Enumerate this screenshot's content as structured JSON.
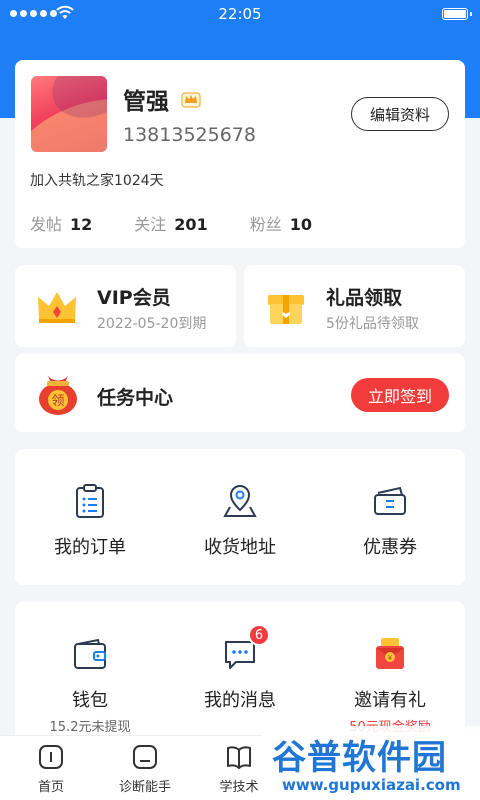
{
  "status_bar": {
    "time": "22:05"
  },
  "profile": {
    "name": "管强",
    "phone": "13813525678",
    "edit_label": "编辑资料",
    "joined": "加入共轨之家1024天",
    "stats": {
      "posts_label": "发帖",
      "posts": "12",
      "follow_label": "关注",
      "follow": "201",
      "fans_label": "粉丝",
      "fans": "10"
    }
  },
  "vip": {
    "title": "VIP会员",
    "subtitle": "2022-05-20到期",
    "icon": "crown-icon"
  },
  "gift": {
    "title": "礼品领取",
    "subtitle": "5份礼品待领取",
    "icon": "gift-box-icon"
  },
  "task": {
    "title": "任务中心",
    "button": "立即签到",
    "icon": "red-pouch-icon",
    "icon_text": "领"
  },
  "grid1": [
    {
      "label": "我的订单",
      "icon": "order-clipboard-icon"
    },
    {
      "label": "收货地址",
      "icon": "location-pin-icon"
    },
    {
      "label": "优惠券",
      "icon": "coupon-icon"
    }
  ],
  "grid2": [
    {
      "label": "钱包",
      "sub": "15.2元未提现",
      "icon": "wallet-icon"
    },
    {
      "label": "我的消息",
      "sub": "",
      "badge": "6",
      "icon": "message-bubble-icon"
    },
    {
      "label": "邀请有礼",
      "sub": "50元现金奖励",
      "icon": "red-envelope-icon"
    }
  ],
  "tabs": [
    {
      "label": "首页",
      "icon": "home-icon"
    },
    {
      "label": "诊断能手",
      "icon": "diagnose-icon"
    },
    {
      "label": "学技术",
      "icon": "book-icon"
    }
  ],
  "watermark": {
    "title": "谷普软件园",
    "url": "www.gupuxiazai.com"
  },
  "colors": {
    "brand_blue": "#1d7ef7",
    "accent_red": "#f23c3c",
    "background": "#f3f5f8"
  }
}
